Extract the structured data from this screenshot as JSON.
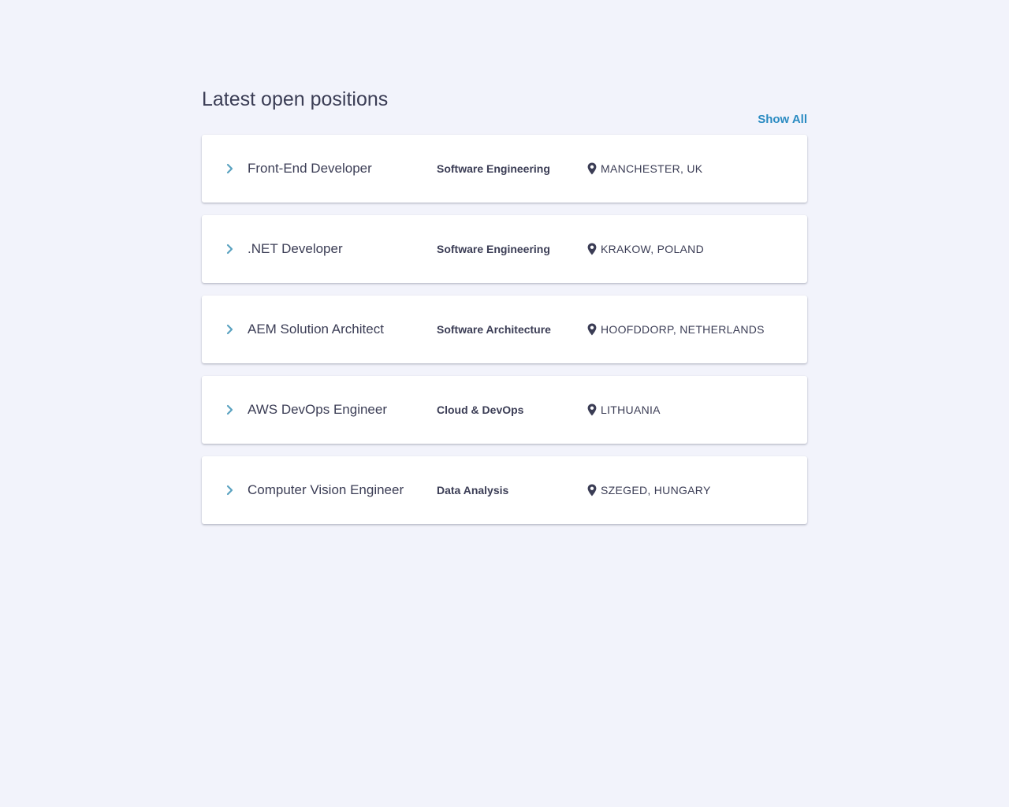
{
  "section": {
    "title": "Latest open positions",
    "show_all_label": "Show All"
  },
  "colors": {
    "background": "#f2f3fb",
    "accent": "#2a8bc2",
    "chevron": "#5aa2c0",
    "text": "#3b3d55"
  },
  "positions": [
    {
      "title": "Front-End Developer",
      "category": "Software Engineering",
      "location": "MANCHESTER, UK",
      "icon": "chevron-right-icon",
      "location_icon": "map-pin-icon"
    },
    {
      "title": ".NET Developer",
      "category": "Software Engineering",
      "location": "KRAKOW, POLAND",
      "icon": "chevron-right-icon",
      "location_icon": "map-pin-icon"
    },
    {
      "title": "AEM Solution Architect",
      "category": "Software Architecture",
      "location": "HOOFDDORP, NETHERLANDS",
      "icon": "chevron-right-icon",
      "location_icon": "map-pin-icon"
    },
    {
      "title": "AWS DevOps Engineer",
      "category": "Cloud & DevOps",
      "location": "LITHUANIA",
      "icon": "chevron-right-icon",
      "location_icon": "map-pin-icon"
    },
    {
      "title": "Computer Vision Engineer",
      "category": "Data Analysis",
      "location": "SZEGED, HUNGARY",
      "icon": "chevron-right-icon",
      "location_icon": "map-pin-icon"
    }
  ]
}
